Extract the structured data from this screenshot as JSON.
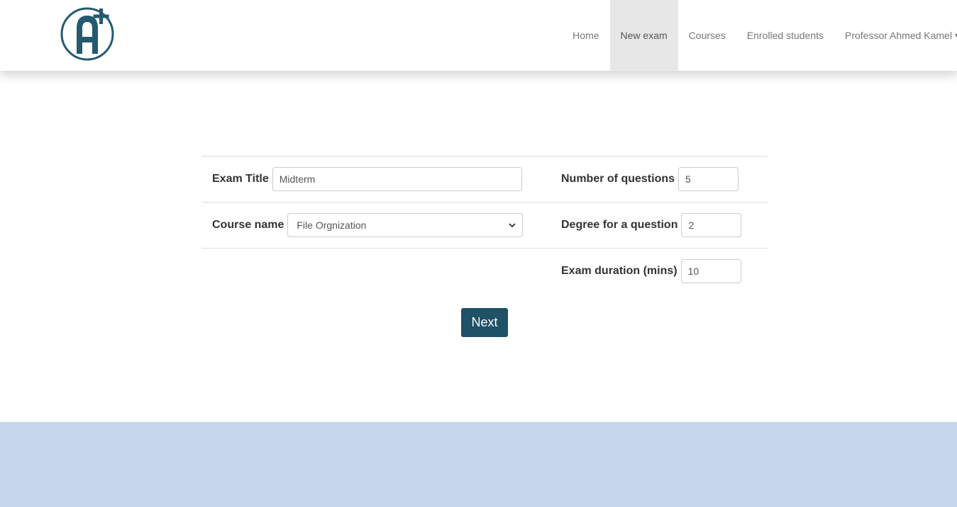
{
  "nav": {
    "items": [
      {
        "label": "Home"
      },
      {
        "label": "New exam"
      },
      {
        "label": "Courses"
      },
      {
        "label": "Enrolled students"
      },
      {
        "label": "Professor Ahmed Kamel"
      }
    ],
    "active_index": 1
  },
  "logo": {
    "letter": "A",
    "plus": "+",
    "color": "#245a70"
  },
  "form": {
    "exam_title_label": "Exam Title",
    "exam_title_value": "Midterm",
    "course_name_label": "Course name",
    "course_name_selected": "File Orgnization",
    "num_questions_label": "Number of questions",
    "num_questions_value": "5",
    "degree_label": "Degree for a question",
    "degree_value": "2",
    "duration_label": "Exam duration (mins)",
    "duration_value": "10"
  },
  "actions": {
    "next_label": "Next"
  },
  "colors": {
    "primary": "#1f5167",
    "footer": "#c5d7ed",
    "active_nav": "#e7e7e7"
  }
}
